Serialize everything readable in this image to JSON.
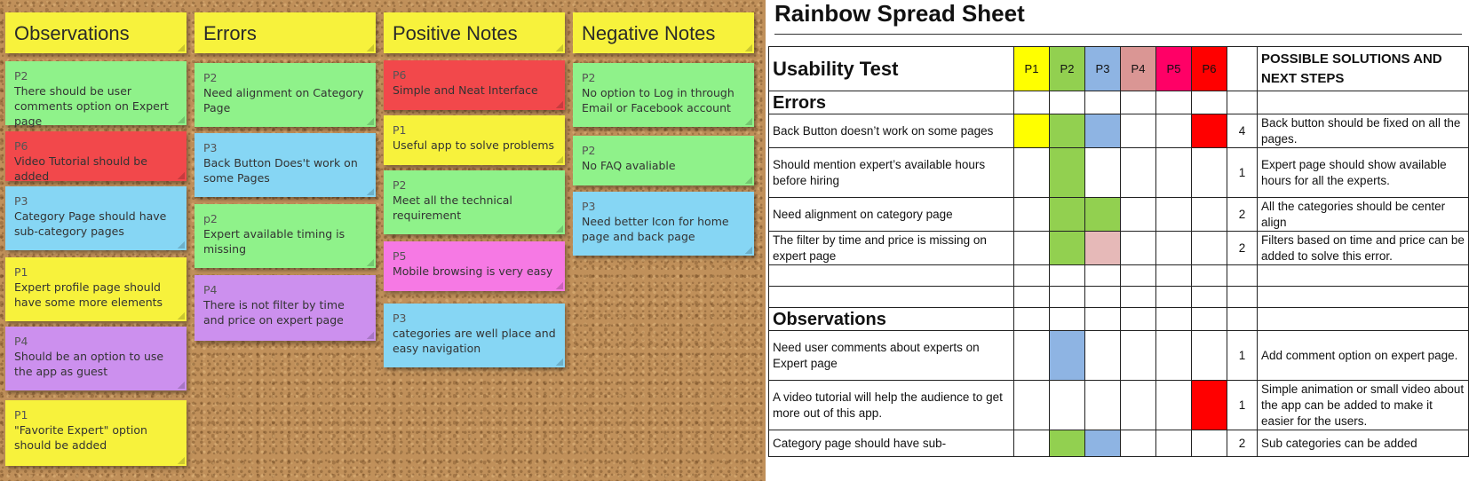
{
  "board": {
    "columns": [
      {
        "title": "Observations",
        "notes": [
          {
            "who": "P2",
            "text": "There should be user comments option on Expert page",
            "color": "green"
          },
          {
            "who": "P6",
            "text": "Video Tutorial should be added",
            "color": "red"
          },
          {
            "who": "P3",
            "text": "Category Page should have sub-category pages",
            "color": "blue"
          },
          {
            "who": "P1",
            "text": "Expert profile page should have some more elements",
            "color": "yellow"
          },
          {
            "who": "P4",
            "text": "Should be an option to use the app as guest",
            "color": "purple"
          },
          {
            "who": "P1",
            "text": "\"Favorite Expert\" option should be added",
            "color": "yellow"
          }
        ]
      },
      {
        "title": "Errors",
        "notes": [
          {
            "who": "P2",
            "text": "Need alignment on Category Page",
            "color": "green"
          },
          {
            "who": "P3",
            "text": "Back Button Does't work on some Pages",
            "color": "blue"
          },
          {
            "who": "p2",
            "text": "Expert available timing is missing",
            "color": "green"
          },
          {
            "who": "P4",
            "text": "There is not filter by time and price on expert page",
            "color": "purple"
          }
        ]
      },
      {
        "title": "Positive Notes",
        "notes": [
          {
            "who": "P6",
            "text": "Simple and Neat Interface",
            "color": "red"
          },
          {
            "who": "P1",
            "text": "Useful app to solve problems",
            "color": "yellow"
          },
          {
            "who": "P2",
            "text": "Meet all the technical requirement",
            "color": "green"
          },
          {
            "who": "P5",
            "text": "Mobile browsing is very easy",
            "color": "pink"
          },
          {
            "who": "P3",
            "text": "categories are well place and easy navigation",
            "color": "blue"
          }
        ]
      },
      {
        "title": "Negative Notes",
        "notes": [
          {
            "who": "P2",
            "text": "No option to Log in through Email or Facebook account",
            "color": "green"
          },
          {
            "who": "P2",
            "text": "No FAQ avaliable",
            "color": "green"
          },
          {
            "who": "P3",
            "text": "Need better Icon for home page and back page",
            "color": "blue"
          }
        ]
      }
    ]
  },
  "sheet": {
    "title": "Rainbow Spread Sheet",
    "table_title": "Usability Test",
    "participants": [
      "P1",
      "P2",
      "P3",
      "P4",
      "P5",
      "P6"
    ],
    "participant_colors": [
      "#ffff00",
      "#92d050",
      "#8eb4e3",
      "#da9694",
      "#ff0066",
      "#ff0000"
    ],
    "solutions_header": "POSSIBLE SOLUTIONS AND NEXT STEPS",
    "sections": {
      "errors": "Errors",
      "observations": "Observations"
    },
    "rows": [
      {
        "issue": "Back Button doesn’t work on some pages",
        "count": "4",
        "solution": "Back button should be fixed on all the pages."
      },
      {
        "issue": "Should mention expert’s available hours before hiring",
        "count": "1",
        "solution": "Expert page should show available hours for all the experts."
      },
      {
        "issue": "Need alignment on category page",
        "count": "2",
        "solution": "All the categories should be center align"
      },
      {
        "issue": "The filter by time and price is missing on expert page",
        "count": "2",
        "solution": "Filters based on time and price can be added to solve this error."
      },
      {
        "issue": "Need user comments about experts on Expert page",
        "count": "1",
        "solution": "Add comment option on expert page."
      },
      {
        "issue": "A video tutorial will help the audience to get more out of this app.",
        "count": "1",
        "solution": "Simple animation or small video about the app can be added to make it easier for the users."
      },
      {
        "issue": "Category page should have sub-",
        "count": "2",
        "solution": "Sub categories can be added"
      }
    ]
  }
}
